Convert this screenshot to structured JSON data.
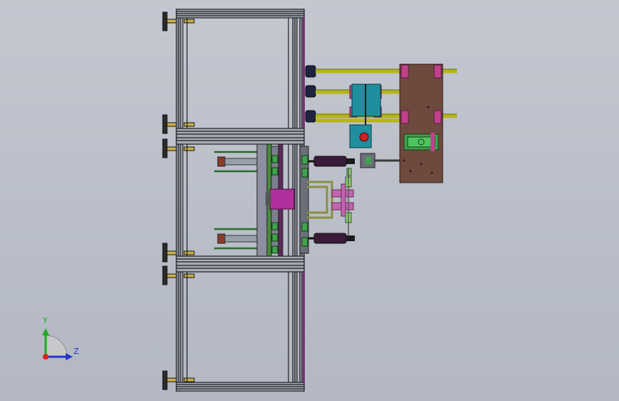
{
  "viewport": {
    "background": "#bcc1cb"
  },
  "triad": {
    "y_label": "Y",
    "z_label": "Z",
    "y_color": "#22aa22",
    "z_color": "#2233cc",
    "x_color": "#dd2222"
  },
  "colors": {
    "frame": "#1e1e22",
    "frame_accent": "#7a2f7a",
    "yellow_rod": "#b5b518",
    "plate_brown": "#6e4a3e",
    "pink_block": "#c2408a",
    "teal_block": "#1f8fa0",
    "green_part": "#3fa34d",
    "cylinder_dark": "#3a1b3a"
  }
}
